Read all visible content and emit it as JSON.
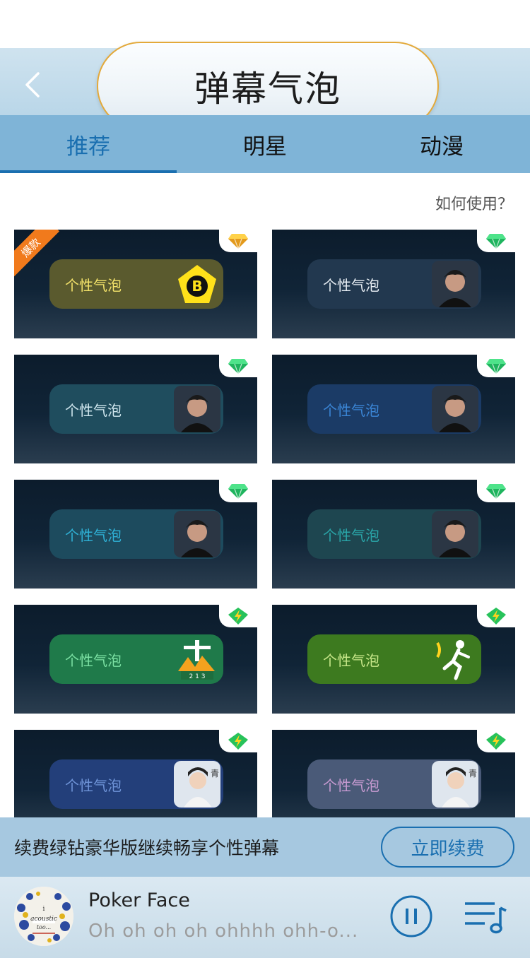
{
  "header": {
    "title": "弹幕气泡"
  },
  "tabs": [
    {
      "label": "推荐",
      "active": true
    },
    {
      "label": "明星",
      "active": false
    },
    {
      "label": "动漫",
      "active": false
    }
  ],
  "howto_label": "如何使用？",
  "cards": [
    {
      "label": "个性气泡",
      "ribbon": "爆款",
      "badge_icon": "gold-diamond-icon",
      "bubble_bg": "#5a5a2e",
      "text_color": "#f3e26a",
      "art": "bigbang-logo"
    },
    {
      "label": "个性气泡",
      "ribbon": "",
      "badge_icon": "green-diamond-icon",
      "bubble_bg": "#22384f",
      "text_color": "#e8eef4",
      "art": "star-portrait"
    },
    {
      "label": "个性气泡",
      "ribbon": "",
      "badge_icon": "green-diamond-icon",
      "bubble_bg": "#1f4d5e",
      "text_color": "#cfe6ee",
      "art": "star-portrait"
    },
    {
      "label": "个性气泡",
      "ribbon": "",
      "badge_icon": "green-diamond-icon",
      "bubble_bg": "#1b3b66",
      "text_color": "#3b86d6",
      "art": "star-portrait"
    },
    {
      "label": "个性气泡",
      "ribbon": "",
      "badge_icon": "green-diamond-icon",
      "bubble_bg": "#1d4b5e",
      "text_color": "#2fb1d6",
      "art": "star-portrait"
    },
    {
      "label": "个性气泡",
      "ribbon": "",
      "badge_icon": "green-diamond-icon",
      "bubble_bg": "#1e4650",
      "text_color": "#2aa6a9",
      "art": "star-portrait"
    },
    {
      "label": "个性气泡",
      "ribbon": "",
      "badge_icon": "lightning-icon",
      "bubble_bg": "#1f7a4a",
      "text_color": "#7be0a3",
      "art": "rio-statue"
    },
    {
      "label": "个性气泡",
      "ribbon": "",
      "badge_icon": "lightning-icon",
      "bubble_bg": "#3d7a1f",
      "text_color": "#c8e78a",
      "art": "runner-figure"
    },
    {
      "label": "个性气泡",
      "ribbon": "",
      "badge_icon": "lightning-icon",
      "bubble_bg": "#233f7a",
      "text_color": "#6f94d8",
      "art": "drama-portrait"
    },
    {
      "label": "个性气泡",
      "ribbon": "",
      "badge_icon": "lightning-icon",
      "bubble_bg": "#4a5a78",
      "text_color": "#c89bd2",
      "art": "drama-portrait"
    }
  ],
  "renew": {
    "message": "续费绿钻豪华版继续畅享个性弹幕",
    "button": "立即续费"
  },
  "player": {
    "song": "Poker Face",
    "lyric": "Oh  oh  oh  oh  ohhhh  ohh-o...",
    "cover_text_1": "i",
    "cover_text_2": "acoustic",
    "cover_text_3": "too..."
  },
  "colors": {
    "accent": "#1a6fb0",
    "tab_bg": "#7fb4d7",
    "ribbon": "#f17a1c"
  }
}
